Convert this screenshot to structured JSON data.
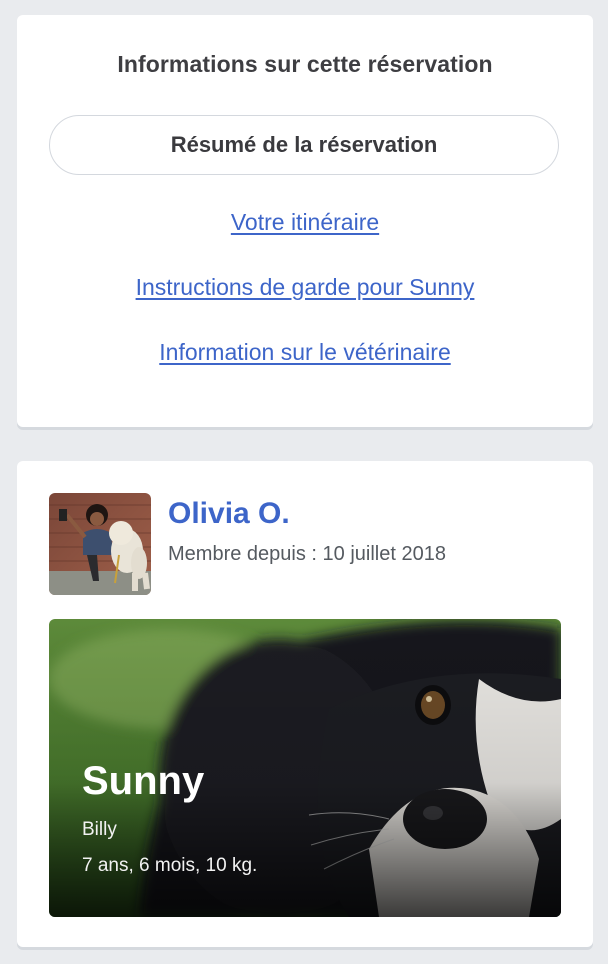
{
  "reservation_info": {
    "title": "Informations sur cette réservation",
    "summary_button": "Résumé de la réservation",
    "links": [
      "Votre itinéraire",
      "Instructions de garde pour Sunny",
      "Information sur le vétérinaire"
    ]
  },
  "owner": {
    "name": "Olivia O.",
    "member_since": "Membre depuis : 10 juillet 2018"
  },
  "pet": {
    "name": "Sunny",
    "breed": "Billy",
    "details": "7 ans, 6 mois, 10 kg."
  },
  "colors": {
    "link": "#3d65c9",
    "background": "#e9ebee",
    "card": "#ffffff"
  }
}
